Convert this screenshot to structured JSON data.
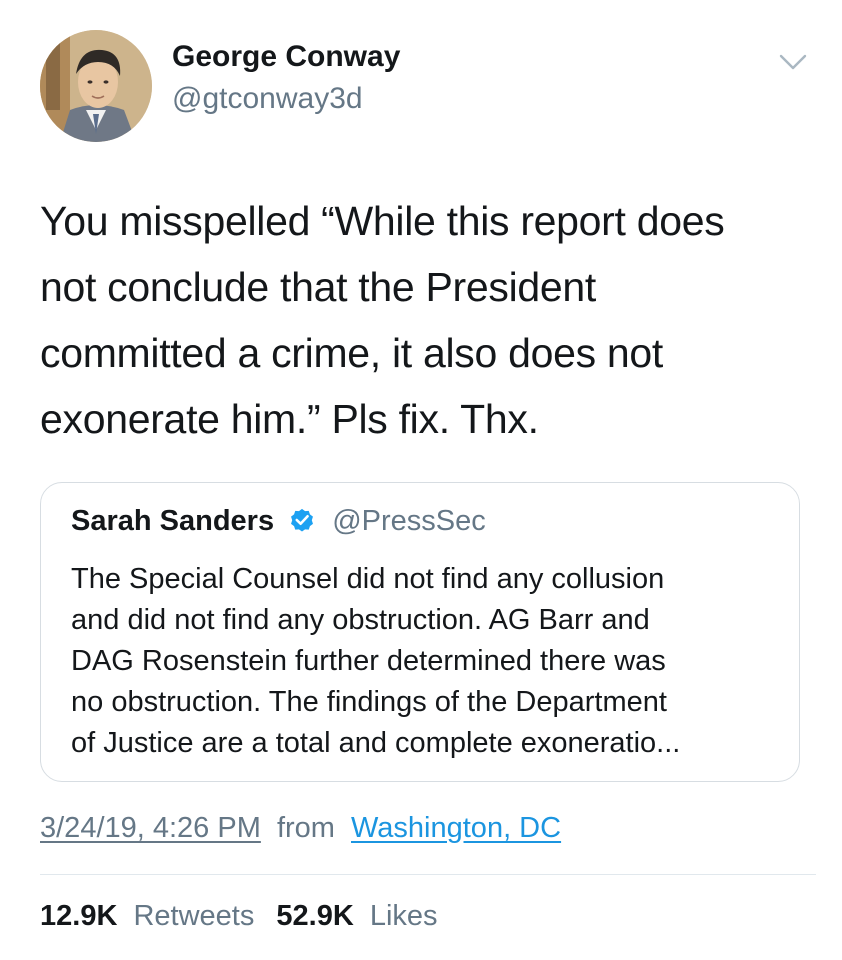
{
  "author": {
    "name": "George Conway",
    "handle": "@gtconway3d",
    "avatar_icon": "profile-avatar-illustration"
  },
  "tweet": {
    "text_lines": [
      "You misspelled “While this report does",
      "not conclude that the President",
      "committed a crime, it also does not",
      "exonerate him.”  Pls fix. Thx."
    ]
  },
  "quoted_tweet": {
    "name": "Sarah Sanders",
    "verified_icon": "verified-badge-icon",
    "handle": "@PressSec",
    "text_lines": [
      "The Special Counsel did not find any collusion",
      "and did not find any obstruction. AG Barr and",
      "DAG Rosenstein further determined there was",
      "no obstruction. The findings of the Department",
      "of Justice are a total and complete exoneratio..."
    ]
  },
  "meta": {
    "timestamp": "3/24/19, 4:26 PM",
    "from_label": "from",
    "location": "Washington, DC"
  },
  "stats": {
    "retweets_count": "12.9K",
    "retweets_label": "Retweets",
    "likes_count": "52.9K",
    "likes_label": "Likes"
  },
  "colors": {
    "text": "#14171a",
    "secondary": "#657786",
    "link": "#1b95e0",
    "verified": "#1da1f2",
    "border": "#d7dde2"
  }
}
